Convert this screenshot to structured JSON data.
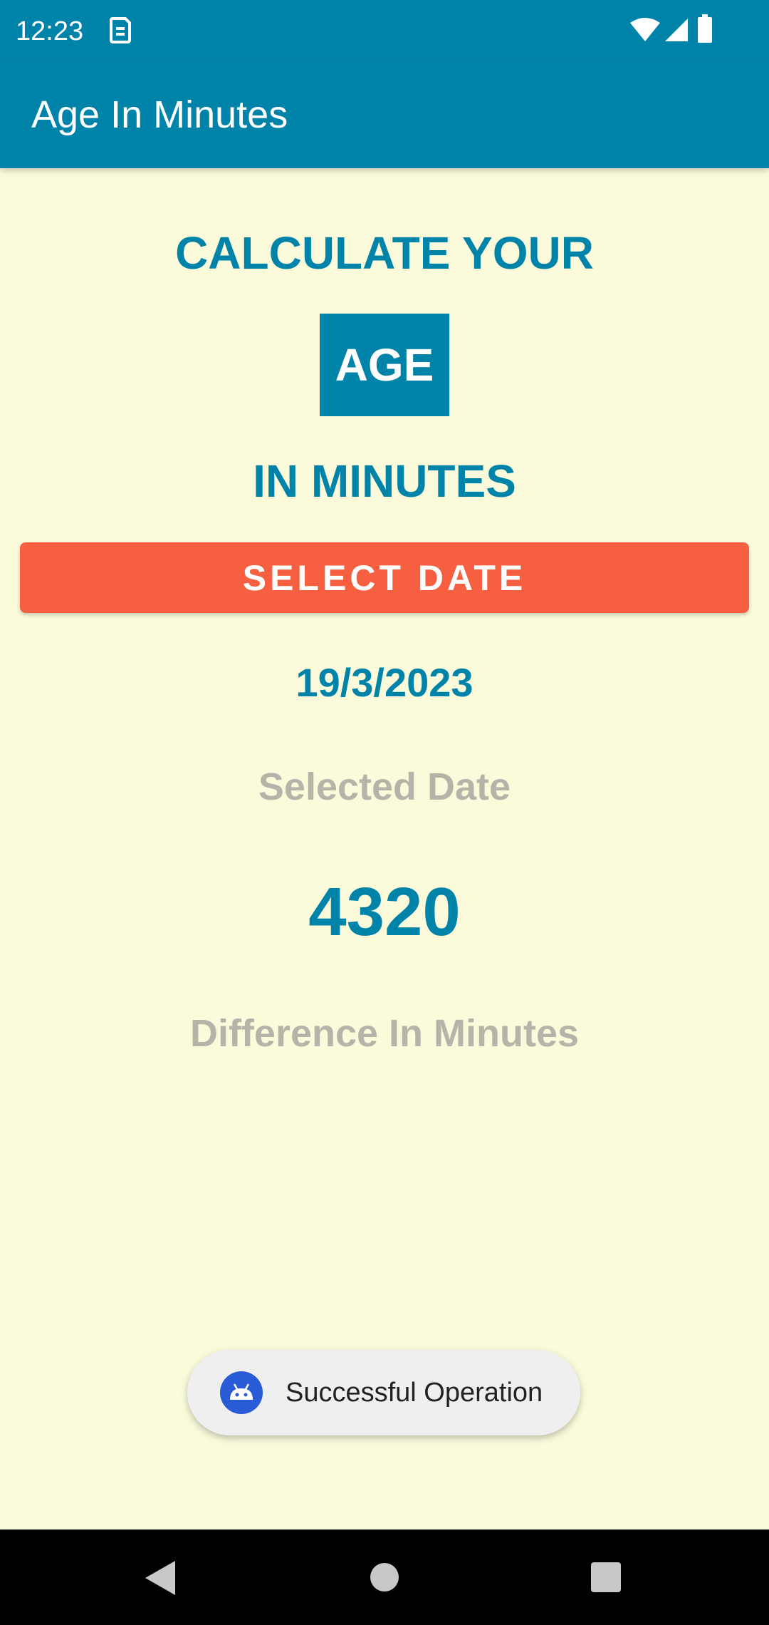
{
  "status_bar": {
    "time": "12:23",
    "notification_icon": "sim-card-icon",
    "icons": [
      "wifi-icon",
      "signal-icon",
      "battery-icon"
    ],
    "color": "#0083A8"
  },
  "app_bar": {
    "title": "Age In Minutes"
  },
  "main": {
    "heading_top": "CALCULATE YOUR",
    "heading_box": "AGE",
    "heading_bottom": "IN MINUTES",
    "select_button_label": "SELECT DATE",
    "selected_date_value": "19/3/2023",
    "selected_date_label": "Selected Date",
    "minutes_value": "4320",
    "minutes_label": "Difference In Minutes"
  },
  "toast": {
    "icon": "android-icon",
    "message": "Successful Operation"
  },
  "nav_bar": {
    "buttons": [
      "back-icon",
      "home-icon",
      "recents-icon"
    ]
  },
  "colors": {
    "primary": "#0083A8",
    "accent": "#F65F40",
    "background": "#FBFBDC",
    "muted_text": "#B4B4A8"
  }
}
